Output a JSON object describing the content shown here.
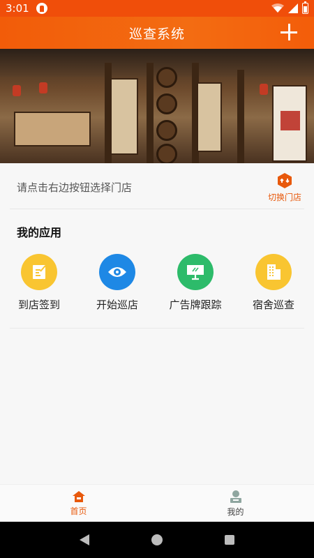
{
  "status_bar": {
    "time": "3:01"
  },
  "app_bar": {
    "title": "巡查系统",
    "action_icon": "plus-icon"
  },
  "store": {
    "hint": "请点击右边按钮选择门店",
    "switch_label": "切换门店",
    "switch_icon": "swap-icon"
  },
  "apps": {
    "title": "我的应用",
    "items": [
      {
        "label": "到店签到",
        "icon": "checkin-icon",
        "color": "#f9c531"
      },
      {
        "label": "开始巡店",
        "icon": "eye-icon",
        "color": "#1e88e5"
      },
      {
        "label": "广告牌跟踪",
        "icon": "billboard-icon",
        "color": "#2dbb6a"
      },
      {
        "label": "宿舍巡查",
        "icon": "building-icon",
        "color": "#f9c531"
      }
    ]
  },
  "tabs": [
    {
      "label": "首页",
      "icon": "home-icon",
      "active": true
    },
    {
      "label": "我的",
      "icon": "profile-icon",
      "active": false
    }
  ],
  "colors": {
    "primary": "#f25c09",
    "accent": "#e8590c"
  }
}
